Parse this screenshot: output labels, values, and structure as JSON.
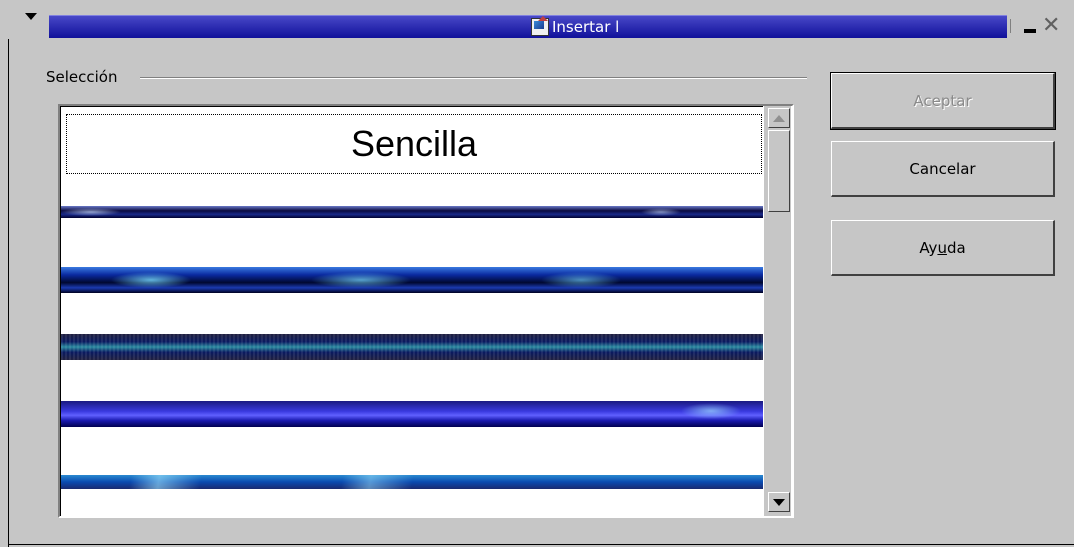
{
  "window": {
    "title": "Insertar l",
    "icon": "app-icon",
    "controls": [
      "menu-arrow-icon",
      "minimize-icon",
      "close-icon"
    ]
  },
  "group": {
    "label": "Selección"
  },
  "list": {
    "items": [
      {
        "label": "Sencilla",
        "type": "text",
        "selected": true
      },
      {
        "label": "",
        "type": "image-line",
        "style": "blue-dark-glow"
      },
      {
        "label": "",
        "type": "image-line",
        "style": "blue-lightning"
      },
      {
        "label": "",
        "type": "image-line",
        "style": "teal-textured"
      },
      {
        "label": "",
        "type": "image-line",
        "style": "bright-blue"
      },
      {
        "label": "",
        "type": "image-line",
        "style": "cyan-streak"
      }
    ]
  },
  "buttons": {
    "accept": "Aceptar",
    "cancel": "Cancelar",
    "help_pre": "Ay",
    "help_mnemonic": "u",
    "help_post": "da"
  },
  "colors": {
    "background": "#c6c6c6",
    "title_bar": "#2020b0",
    "disabled_text": "#8a8a8a"
  }
}
